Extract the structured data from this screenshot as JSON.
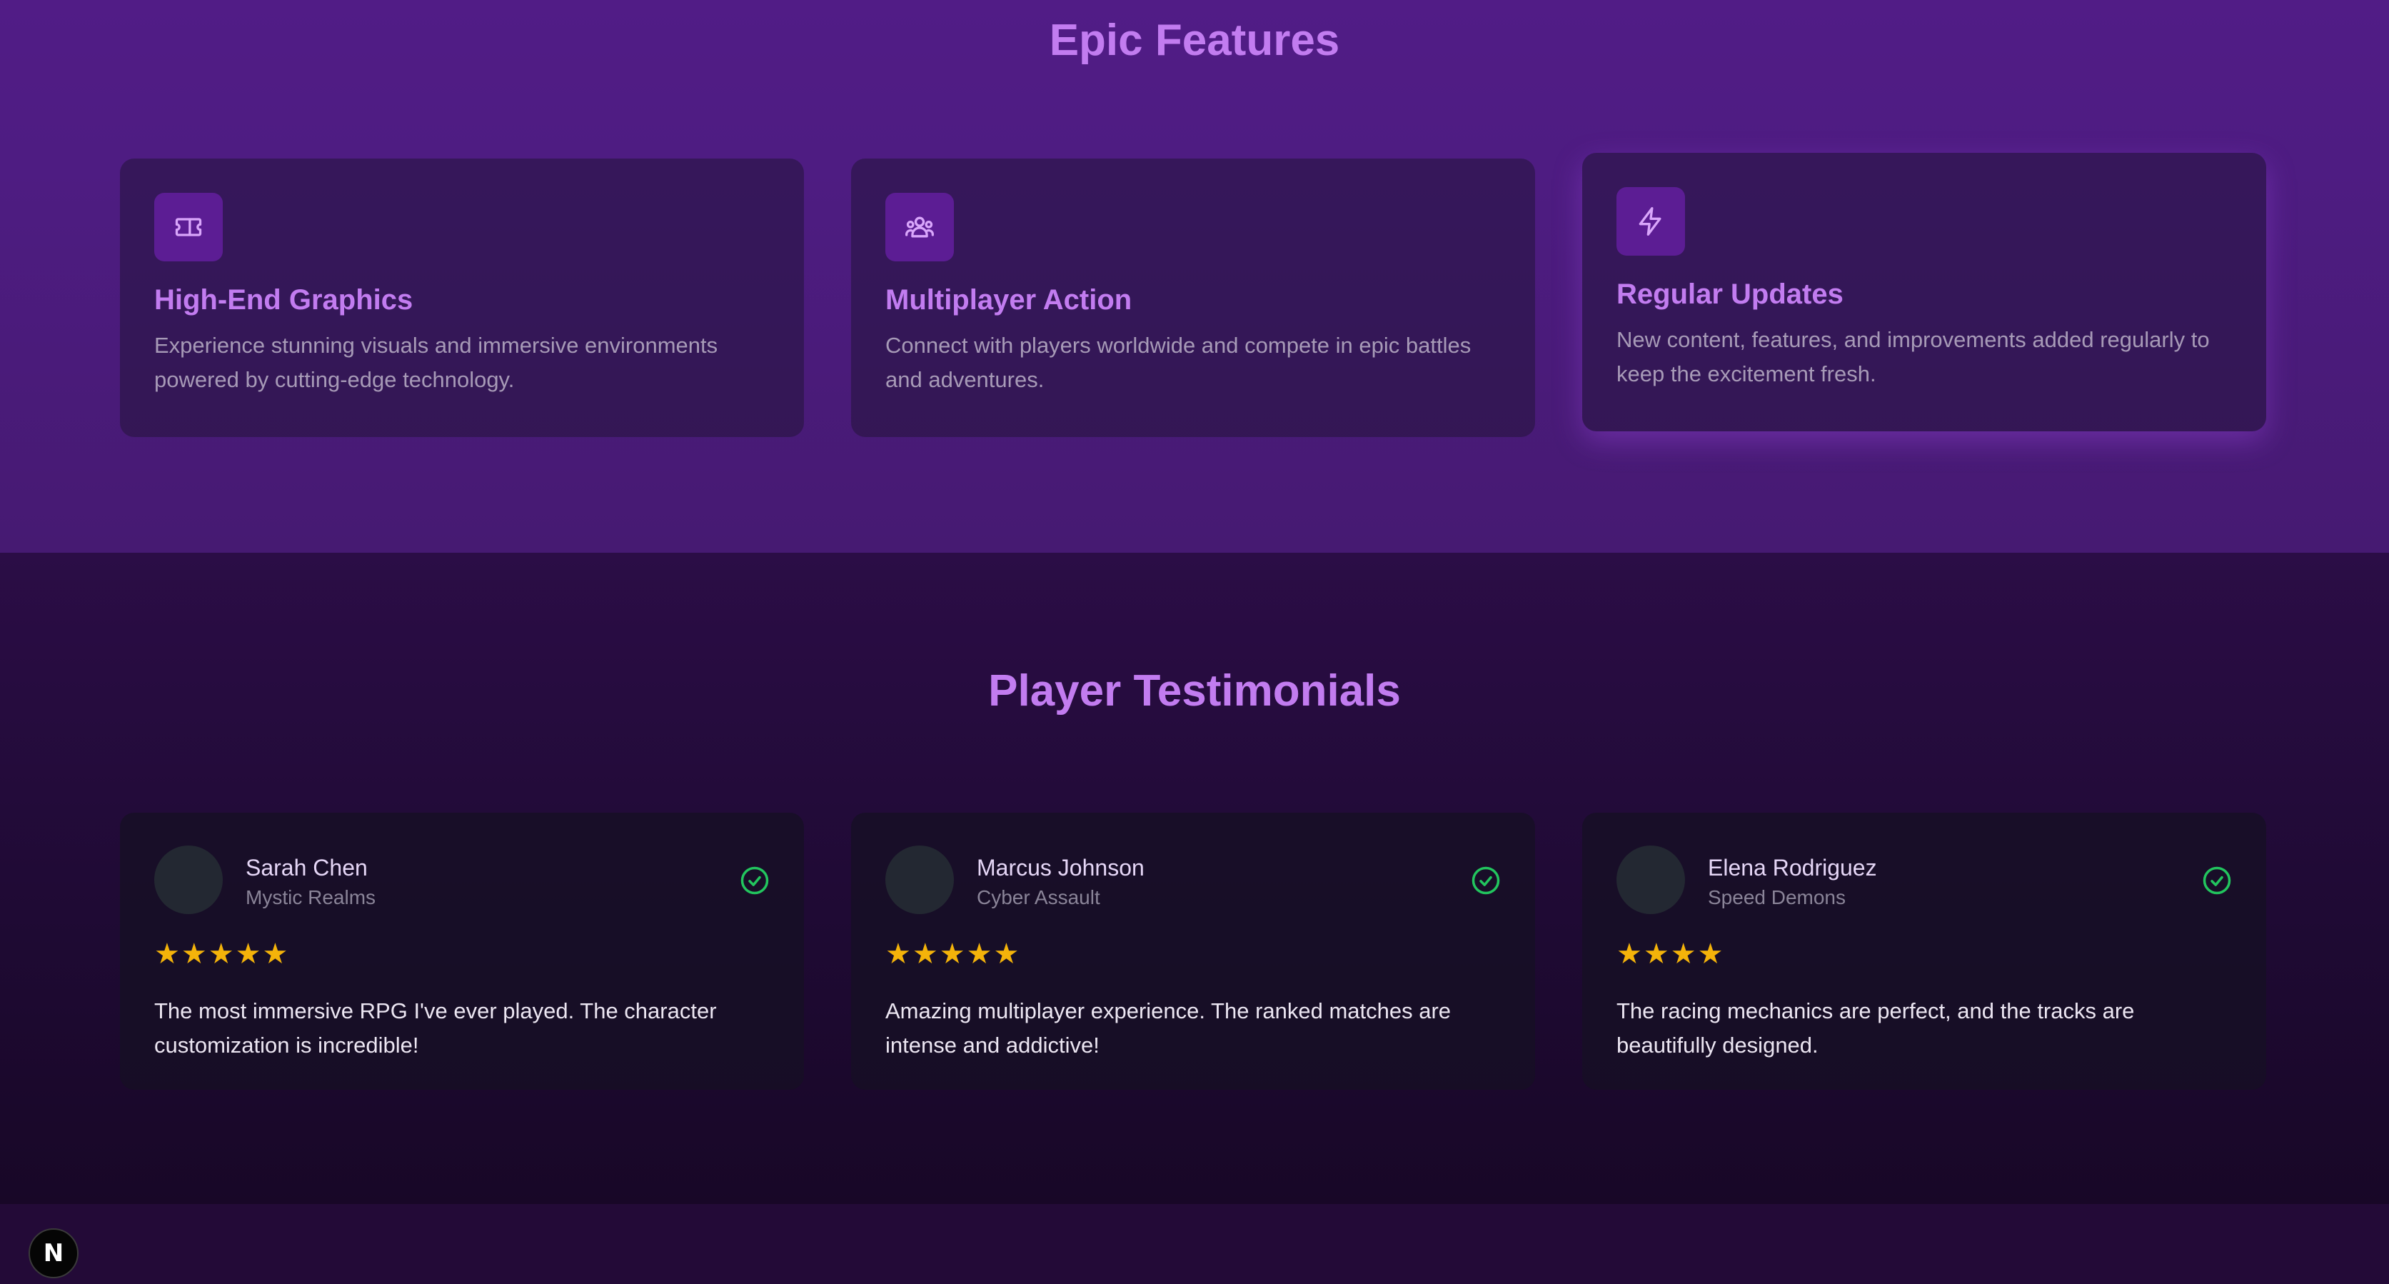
{
  "features_section": {
    "title": "Epic Features",
    "cards": [
      {
        "icon": "ticket-icon",
        "title": "High-End Graphics",
        "description": "Experience stunning visuals and immersive environments powered by cutting-edge technology."
      },
      {
        "icon": "users-icon",
        "title": "Multiplayer Action",
        "description": "Connect with players worldwide and compete in epic battles and adventures."
      },
      {
        "icon": "lightning-icon",
        "title": "Regular Updates",
        "description": "New content, features, and improvements added regularly to keep the excitement fresh."
      }
    ]
  },
  "testimonials_section": {
    "title": "Player Testimonials",
    "items": [
      {
        "name": "Sarah Chen",
        "game": "Mystic Realms",
        "rating": 5,
        "stars": "★★★★★",
        "quote": "The most immersive RPG I've ever played. The character customization is incredible!"
      },
      {
        "name": "Marcus Johnson",
        "game": "Cyber Assault",
        "rating": 5,
        "stars": "★★★★★",
        "quote": "Amazing multiplayer experience. The ranked matches are intense and addictive!"
      },
      {
        "name": "Elena Rodriguez",
        "game": "Speed Demons",
        "rating": 4,
        "stars": "★★★★",
        "quote": "The racing mechanics are perfect, and the tracks are beautifully designed."
      }
    ]
  },
  "dev_badge": {
    "label": "N"
  },
  "colors": {
    "accent": "#c27cf0",
    "star": "#f4b30a",
    "verified": "#22c55e"
  }
}
